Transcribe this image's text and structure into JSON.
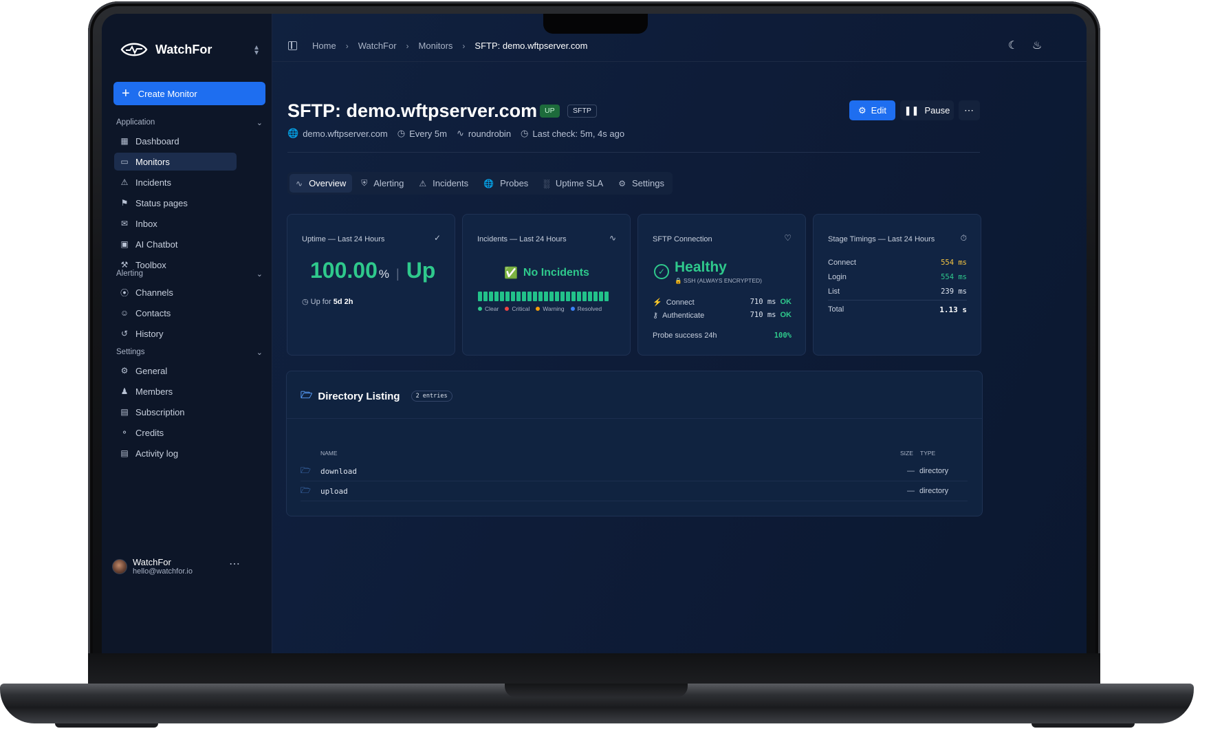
{
  "brand": {
    "name": "WatchFor"
  },
  "sidebar": {
    "create_label": "Create Monitor",
    "sections": [
      {
        "title": "Application",
        "items": [
          "Dashboard",
          "Monitors",
          "Incidents",
          "Status pages",
          "Inbox",
          "AI Chatbot",
          "Toolbox"
        ]
      },
      {
        "title": "Alerting",
        "items": [
          "Channels",
          "Contacts",
          "History"
        ]
      },
      {
        "title": "Settings",
        "items": [
          "General",
          "Members",
          "Subscription",
          "Credits",
          "Activity log"
        ]
      }
    ],
    "active_item": "Monitors",
    "user": {
      "name": "WatchFor",
      "email": "hello@watchfor.io"
    }
  },
  "breadcrumb": [
    "Home",
    "WatchFor",
    "Monitors",
    "SFTP: demo.wftpserver.com"
  ],
  "header": {
    "title": "SFTP: demo.wftpserver.com",
    "status_badge": "UP",
    "type_badge": "SFTP",
    "meta": {
      "host": "demo.wftpserver.com",
      "interval": "Every 5m",
      "strategy": "roundrobin",
      "last_check": "Last check: 5m, 4s ago"
    },
    "actions": {
      "edit": "Edit",
      "pause": "Pause",
      "more": "⋯"
    }
  },
  "tabs": [
    "Overview",
    "Alerting",
    "Incidents",
    "Probes",
    "Uptime SLA",
    "Settings"
  ],
  "cards": {
    "uptime": {
      "title": "Uptime — Last 24 Hours",
      "value": "100.00",
      "unit": "%",
      "sep": "|",
      "status": "Up",
      "up_for_label": "Up for",
      "up_for_value": "5d 2h"
    },
    "incidents": {
      "title": "Incidents — Last 24 Hours",
      "status": "No Incidents",
      "bar_count": 24,
      "legend": [
        "Clear",
        "Critical",
        "Warning",
        "Resolved"
      ]
    },
    "sftp": {
      "title": "SFTP Connection",
      "status": "Healthy",
      "subtitle": "SSH (ALWAYS ENCRYPTED)",
      "rows": [
        {
          "label": "Connect",
          "value": "710 ms",
          "state": "OK"
        },
        {
          "label": "Authenticate",
          "value": "710 ms",
          "state": "OK"
        }
      ],
      "probe_label": "Probe success 24h",
      "probe_value": "100%"
    },
    "timings": {
      "title": "Stage Timings — Last 24 Hours",
      "rows": [
        {
          "label": "Connect",
          "value": "554 ms"
        },
        {
          "label": "Login",
          "value": "554 ms"
        },
        {
          "label": "List",
          "value": "239 ms"
        }
      ],
      "total_label": "Total",
      "total_value": "1.13 s"
    }
  },
  "directory": {
    "title": "Directory Listing",
    "count": "2 entries",
    "columns": {
      "name": "NAME",
      "size": "SIZE",
      "type": "TYPE"
    },
    "rows": [
      {
        "name": "download",
        "size": "—",
        "type": "directory"
      },
      {
        "name": "upload",
        "size": "—",
        "type": "directory"
      }
    ]
  },
  "colors": {
    "accent": "#1e6ef0",
    "success": "#2fc98c",
    "warning": "#f5c542",
    "critical": "#ef4444",
    "background": "#0c1629"
  }
}
